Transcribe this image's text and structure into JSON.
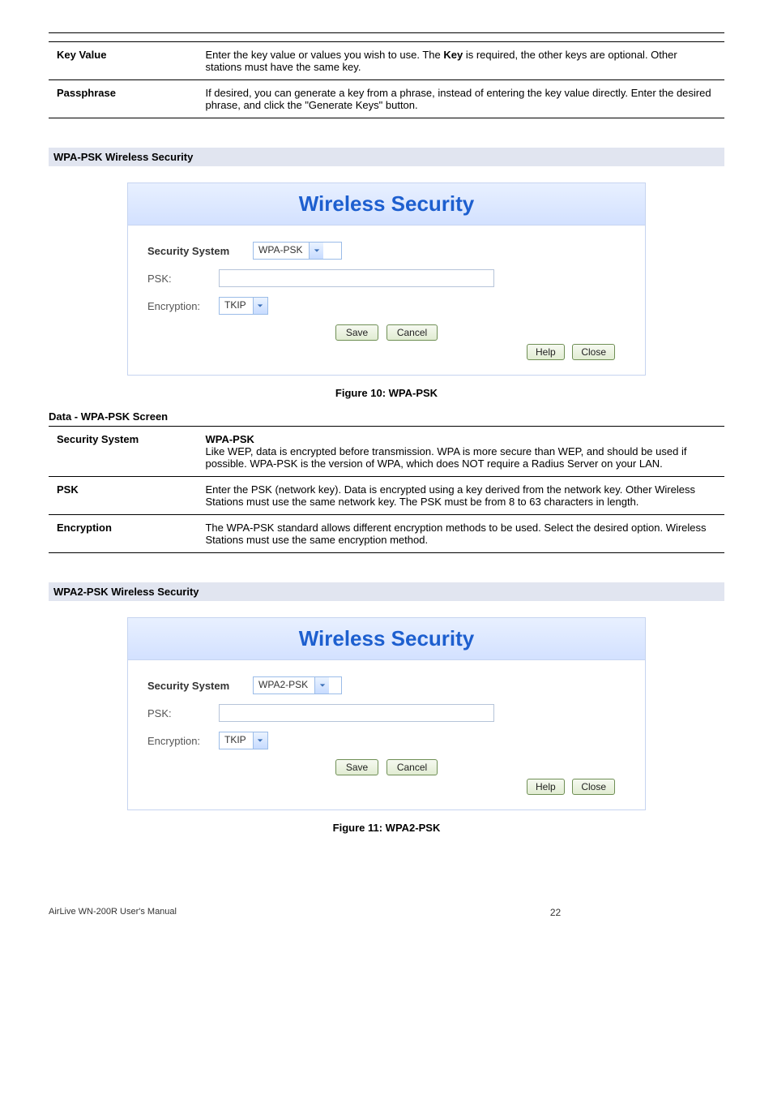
{
  "topTable": [
    {
      "label": "Key Value",
      "desc_pre": "Enter the key value or values you wish to use. The ",
      "desc_bold": "Key",
      "desc_post": " is required, the other keys are optional. Other stations must have the same key."
    },
    {
      "label": "Passphrase",
      "desc": "If desired, you can generate a key from a phrase, instead of entering the key value directly. Enter the desired phrase, and click the \"Generate Keys\" button."
    }
  ],
  "section1Heading": "WPA-PSK Wireless Security",
  "panel1": {
    "title": "Wireless Security",
    "securityLabel": "Security System",
    "securityValue": "WPA-PSK",
    "pskLabel": "PSK:",
    "encLabel": "Encryption:",
    "encValue": "TKIP",
    "saveBtn": "Save",
    "cancelBtn": "Cancel",
    "helpBtn": "Help",
    "closeBtn": "Close"
  },
  "figure10": "Figure 10: WPA-PSK",
  "dataHeading1": "Data - WPA-PSK Screen",
  "dataTable1": [
    {
      "label": "Security System",
      "heading": "WPA-PSK",
      "desc": "Like WEP, data is encrypted before transmission. WPA is more secure than WEP, and should be used if possible. WPA-PSK is the version of WPA, which does NOT require a Radius Server on your LAN."
    },
    {
      "label": "PSK",
      "desc": "Enter the PSK (network key). Data is encrypted using a key derived from the network key. Other Wireless Stations must use the same network key. The PSK must be from 8 to 63 characters in length."
    },
    {
      "label": "Encryption",
      "desc": "The WPA-PSK standard allows different encryption methods to be used. Select the desired option. Wireless Stations must use the same encryption method."
    }
  ],
  "section2Heading": "WPA2-PSK Wireless Security",
  "panel2": {
    "title": "Wireless Security",
    "securityLabel": "Security System",
    "securityValue": "WPA2-PSK",
    "pskLabel": "PSK:",
    "encLabel": "Encryption:",
    "encValue": "TKIP",
    "saveBtn": "Save",
    "cancelBtn": "Cancel",
    "helpBtn": "Help",
    "closeBtn": "Close"
  },
  "figure11": "Figure 11: WPA2-PSK",
  "footer": {
    "manual": "AirLive WN-200R User's Manual",
    "page": "22"
  }
}
